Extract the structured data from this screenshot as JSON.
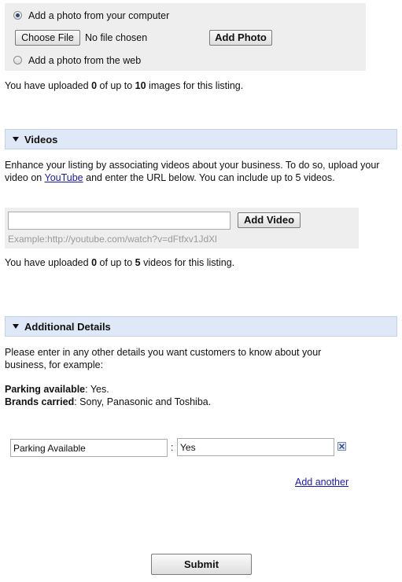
{
  "photos": {
    "option_computer": "Add a photo from your computer",
    "choose_file_label": "Choose File",
    "file_status": "No file chosen",
    "add_photo_label": "Add Photo",
    "option_web": "Add a photo from the web",
    "status_prefix": "You have uploaded ",
    "uploaded_count": "0",
    "status_middle": " of up to ",
    "max_count": "10",
    "status_suffix": " images for this listing."
  },
  "videos": {
    "title": "Videos",
    "desc_part1": "Enhance your listing by associating videos about your business. To do so, upload your video on ",
    "youtube_link": "YouTube",
    "desc_part2": " and enter the URL below. You can include up to 5 videos.",
    "url_value": "",
    "add_video_label": "Add Video",
    "example_text": "Example:http://youtube.com/watch?v=dFtfxv1JdXl",
    "status_prefix": "You have uploaded ",
    "uploaded_count": "0",
    "status_middle": " of up to ",
    "max_count": "5",
    "status_suffix": " videos for this listing."
  },
  "details": {
    "title": "Additional Details",
    "intro": "Please enter in any other details you want customers to know about your business, for example:",
    "example1_label": "Parking available",
    "example1_value": ": Yes.",
    "example2_label": "Brands carried",
    "example2_value": ": Sony, Panasonic and Toshiba.",
    "detail_name_value": "Parking Available",
    "separator": ":",
    "detail_value_value": "Yes",
    "add_another_label": "Add another"
  },
  "submit_label": "Submit"
}
